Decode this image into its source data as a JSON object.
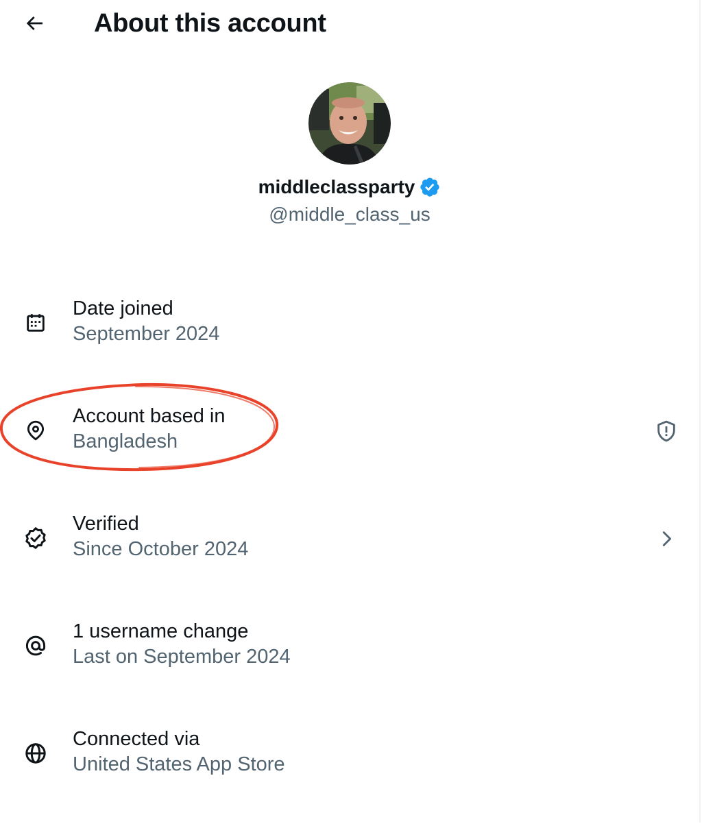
{
  "header": {
    "title": "About this account",
    "back_icon": "arrow-left-icon"
  },
  "profile": {
    "display_name": "middleclassparty",
    "username": "@middle_class_us",
    "verified_badge_color": "#1d9bf0"
  },
  "rows": [
    {
      "icon": "calendar-icon",
      "label": "Date joined",
      "value": "September 2024"
    },
    {
      "icon": "location-pin-icon",
      "label": "Account based in",
      "value": "Bangladesh",
      "right_icon": "shield-alert-icon"
    },
    {
      "icon": "verified-badge-outline-icon",
      "label": "Verified",
      "value": "Since October 2024",
      "right_icon": "chevron-right-icon"
    },
    {
      "icon": "at-sign-icon",
      "label": "1 username change",
      "value": "Last on September 2024"
    },
    {
      "icon": "globe-icon",
      "label": "Connected via",
      "value": "United States App Store"
    }
  ],
  "colors": {
    "primary_text": "#0f1419",
    "secondary_text": "#536471",
    "accent": "#1d9bf0",
    "annotation": "#e8432a"
  }
}
